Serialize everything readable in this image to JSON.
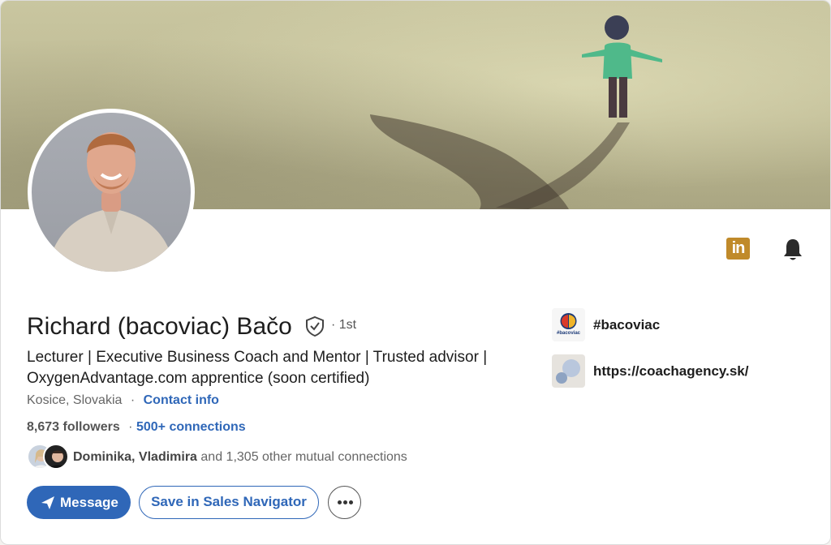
{
  "profile": {
    "name": "Richard (bacoviac) Bačo",
    "degree": "· 1st",
    "headline": "Lecturer | Executive Business Coach and Mentor | Trusted advisor | OxygenAdvantage.com apprentice (soon certified)",
    "location": "Kosice, Slovakia",
    "contact_info": "Contact info",
    "followers": "8,673 followers",
    "separator": "·",
    "connections": "500+ connections"
  },
  "mutual": {
    "names_1": "Dominika",
    "comma": ",",
    "names_2": "Vladimira",
    "rest": "and 1,305 other mutual connections"
  },
  "actions": {
    "message": "Message",
    "save_sales_nav": "Save in Sales Navigator"
  },
  "side_links": [
    {
      "label": "#bacoviac",
      "logo_text": "#bacoviac",
      "icon": "bacoviac-logo"
    },
    {
      "label": "https://coachagency.sk/",
      "icon": "coachagency-logo"
    }
  ],
  "header_icons": {
    "linkedin": "in",
    "bell": "bell-icon"
  },
  "colors": {
    "link_blue": "#2f67b8",
    "linkedin_gold": "#c08a2a",
    "banner_tone": "#c9c6a0"
  }
}
